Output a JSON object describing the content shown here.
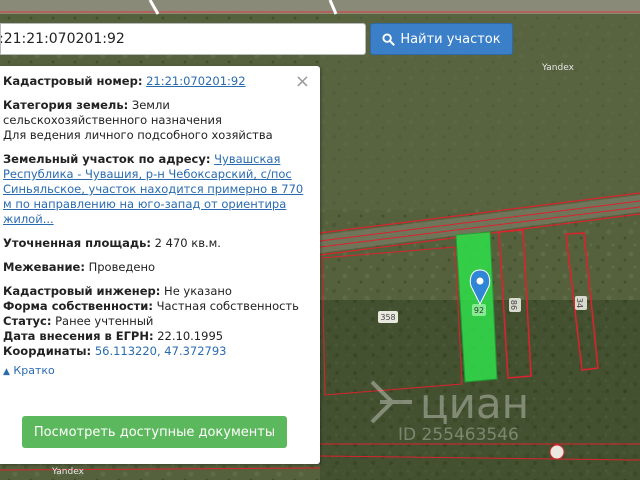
{
  "search": {
    "value": ":21:21:070201:92",
    "button_label": "Найти участок"
  },
  "panel": {
    "cadastral_label": "Кадастровый номер:",
    "cadastral_value": "21:21:070201:92",
    "category_label": "Категория земель:",
    "category_value_1": "Земли",
    "category_value_2": "сельскохозяйственного назначения",
    "category_value_3": "Для ведения личного подсобного хозяйства",
    "address_label": "Земельный участок по адресу:",
    "address_line_1": "Чувашская",
    "address_line_2": "Республика - Чувашия, р-н Чебоксарский, с/пос",
    "address_line_3": "Синьяльское, участок находится примерно в 770",
    "address_line_4": "м по направлению на юго-запад от ориентира",
    "address_line_5": "жилой...",
    "area_label": "Уточненная площадь:",
    "area_value": "2 470 кв.м.",
    "survey_label": "Межевание:",
    "survey_value": "Проведено",
    "engineer_label": "Кадастровый инженер:",
    "engineer_value": "Не указано",
    "ownership_label": "Форма собственности:",
    "ownership_value": "Частная собственность",
    "status_label": "Статус:",
    "status_value": "Ранее учтенный",
    "egrn_label": "Дата внесения в ЕГРН:",
    "egrn_value": "22.10.1995",
    "coords_label": "Координаты:",
    "coords_value": "56.113220, 47.372793",
    "collapse_label": "Кратко",
    "docs_button_label": "Посмотреть доступные документы"
  },
  "map": {
    "parcel_label_main": "92",
    "parcel_label_right_1": "86",
    "parcel_label_right_2": "34",
    "road_label": "358",
    "yandex_label_top": "Yandex",
    "yandex_label_bottom": "Yandex",
    "watermark_text": "циан",
    "watermark_id": "ID 255463546"
  },
  "colors": {
    "accent": "#3a7fc7",
    "docs_button": "#5cb85c",
    "parcel_fill": "#2fe04a",
    "parcel_border": "#d9232e"
  }
}
